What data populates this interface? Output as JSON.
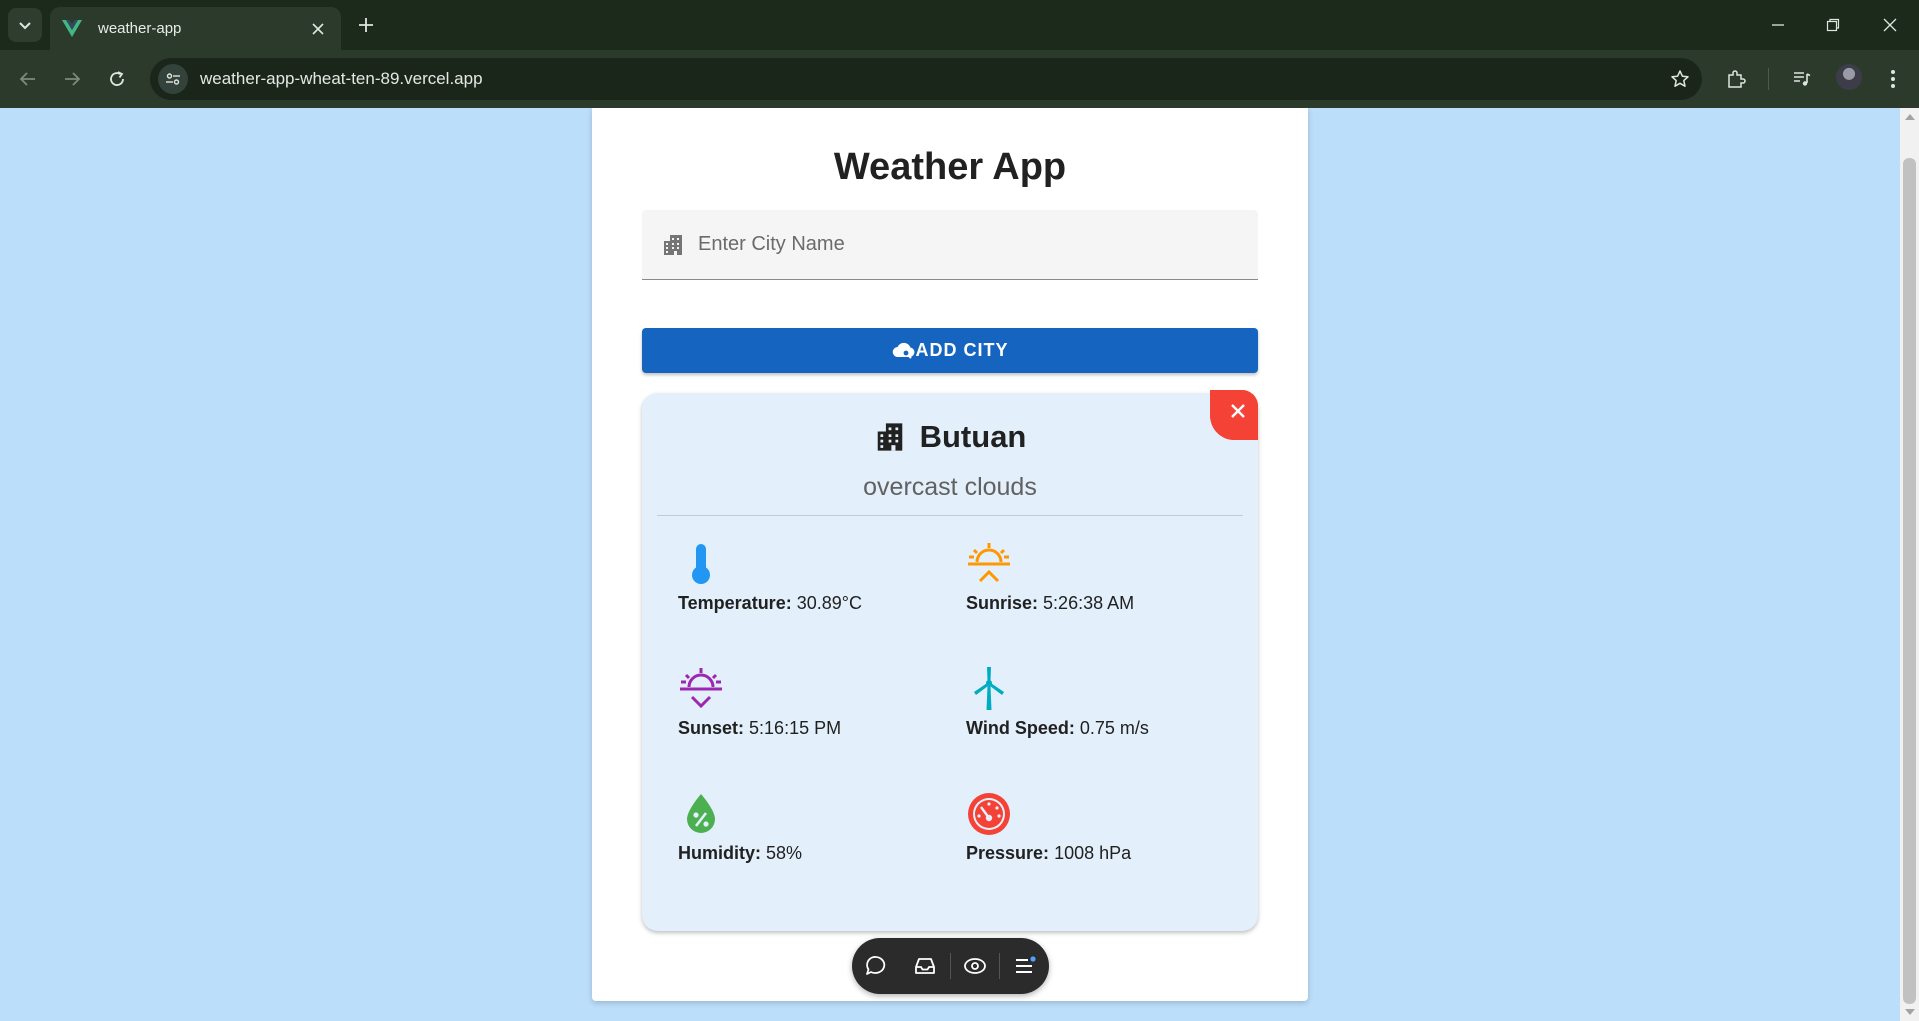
{
  "browser": {
    "tab_title": "weather-app",
    "url": "weather-app-wheat-ten-89.vercel.app",
    "icons": [
      "tab-search-icon",
      "vue-favicon",
      "close-icon",
      "plus-icon",
      "minimize-icon",
      "restore-icon",
      "close-window-icon",
      "back-icon",
      "forward-icon",
      "reload-icon",
      "site-info-icon",
      "star-icon",
      "extensions-icon",
      "media-icon",
      "avatar"
    ]
  },
  "app": {
    "title": "Weather App",
    "search": {
      "placeholder": "Enter City Name",
      "value": ""
    },
    "add_button_label": "ADD CITY",
    "colors": {
      "primary": "#1565c0",
      "page_background": "#bbdefb",
      "card_background": "#e3f0fb",
      "remove": "#f44336"
    }
  },
  "weather": {
    "city": "Butuan",
    "condition": "overcast clouds",
    "stats": [
      {
        "label": "Temperature:",
        "value": "30.89°C",
        "icon": "thermometer-icon",
        "color": "#2196f3"
      },
      {
        "label": "Sunrise:",
        "value": "5:26:38 AM",
        "icon": "sunrise-icon",
        "color": "#ff9800"
      },
      {
        "label": "Sunset:",
        "value": "5:16:15 PM",
        "icon": "sunset-icon",
        "color": "#9c27b0"
      },
      {
        "label": "Wind Speed:",
        "value": "0.75 m/s",
        "icon": "wind-turbine-icon",
        "color": "#00acc1"
      },
      {
        "label": "Humidity:",
        "value": "58%",
        "icon": "humidity-icon",
        "color": "#4caf50"
      },
      {
        "label": "Pressure:",
        "value": "1008 hPa",
        "icon": "gauge-icon",
        "color": "#f44336"
      }
    ]
  },
  "overlay_toolbar": {
    "icons": [
      "comment-icon",
      "inbox-icon",
      "eye-icon",
      "menu-icon"
    ]
  }
}
